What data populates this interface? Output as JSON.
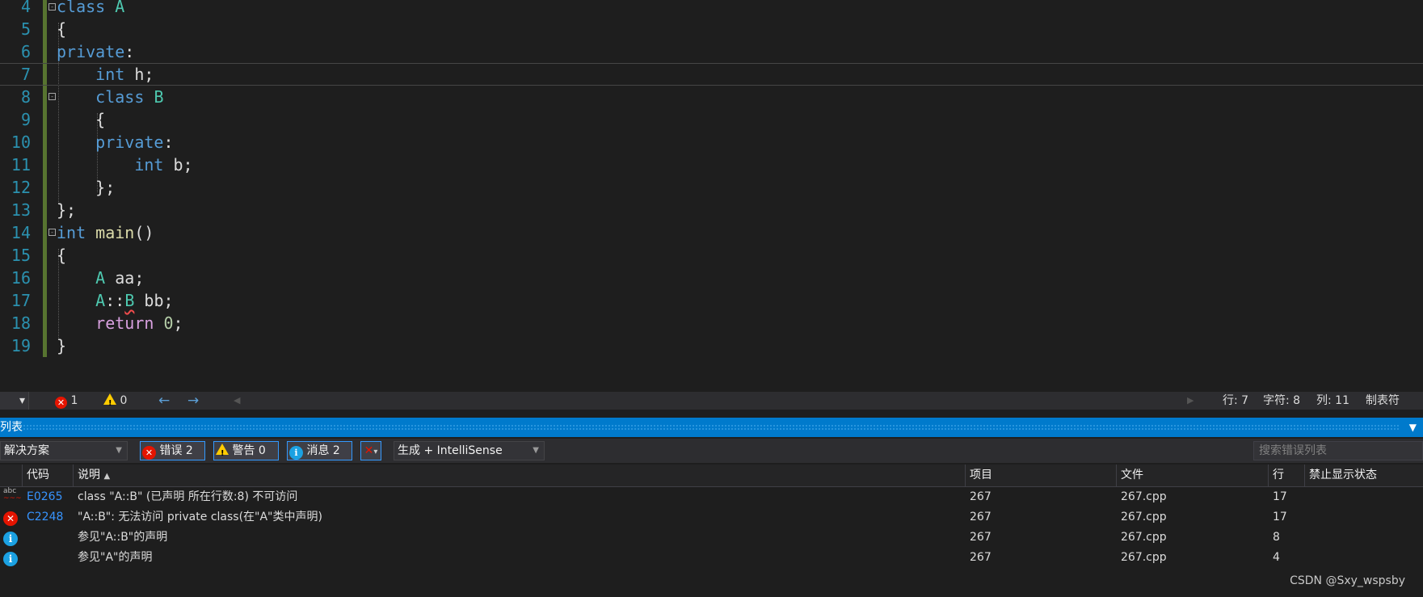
{
  "editor": {
    "lines": [
      {
        "n": "4",
        "html": "<span class='kw'>class</span> <span class='ty'>A</span>"
      },
      {
        "n": "5",
        "html": "{"
      },
      {
        "n": "6",
        "html": "<span class='kw'>private</span>:"
      },
      {
        "n": "7",
        "html": "    <span class='kw'>int</span> h;"
      },
      {
        "n": "8",
        "html": "    <span class='kw'>class</span> <span class='ty'>B</span>"
      },
      {
        "n": "9",
        "html": "    {"
      },
      {
        "n": "10",
        "html": "    <span class='kw'>private</span>:"
      },
      {
        "n": "11",
        "html": "        <span class='kw'>int</span> b;"
      },
      {
        "n": "12",
        "html": "    };"
      },
      {
        "n": "13",
        "html": "};"
      },
      {
        "n": "14",
        "html": "<span class='kw'>int</span> <span class='fn'>main</span>()"
      },
      {
        "n": "15",
        "html": "{"
      },
      {
        "n": "16",
        "html": "    <span class='ty'>A</span> aa;"
      },
      {
        "n": "17",
        "html": "    <span class='ty'>A</span>::<span class='ty squig'>B</span> bb;"
      },
      {
        "n": "18",
        "html": "    <span class='ctl'>return</span> <span class='num'>0</span>;"
      },
      {
        "n": "19",
        "html": "}"
      }
    ]
  },
  "status": {
    "errors": "1",
    "warnings": "0",
    "line": "行: 7",
    "char": "字符: 8",
    "col": "列: 11",
    "tabs": "制表符"
  },
  "panel": {
    "title": "列表",
    "scope": "解决方案",
    "errors_btn": "错误 2",
    "warnings_btn": "警告 0",
    "messages_btn": "消息 2",
    "build_filter": "生成 + IntelliSense",
    "search_placeholder": "搜索错误列表",
    "columns": {
      "code": "代码",
      "desc": "说明",
      "project": "项目",
      "file": "文件",
      "line": "行",
      "suppress": "禁止显示状态"
    },
    "rows": [
      {
        "icon": "abc",
        "code": "E0265",
        "desc": "class \"A::B\" (已声明 所在行数:8) 不可访问",
        "project": "267",
        "file": "267.cpp",
        "line": "17"
      },
      {
        "icon": "error",
        "code": "C2248",
        "desc": "\"A::B\": 无法访问 private class(在\"A\"类中声明)",
        "project": "267",
        "file": "267.cpp",
        "line": "17"
      },
      {
        "icon": "info",
        "code": "",
        "desc": "参见\"A::B\"的声明",
        "project": "267",
        "file": "267.cpp",
        "line": "8"
      },
      {
        "icon": "info",
        "code": "",
        "desc": "参见\"A\"的声明",
        "project": "267",
        "file": "267.cpp",
        "line": "4"
      }
    ]
  },
  "watermark": "CSDN @Sxy_wspsby"
}
